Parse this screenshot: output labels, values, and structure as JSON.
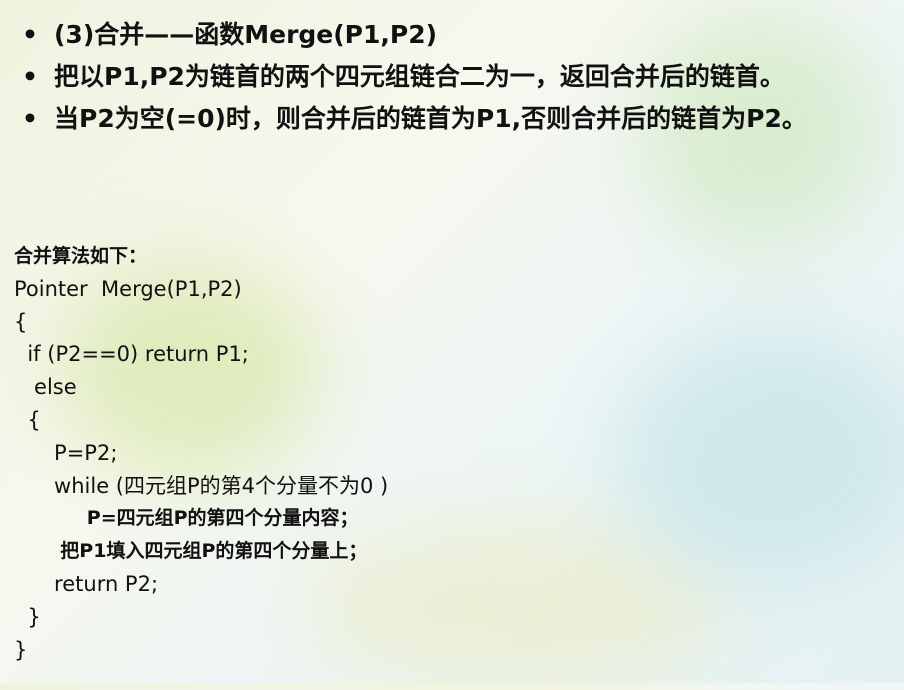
{
  "bullets": [
    {
      "marker": "•",
      "text": "(3)合并——函数Merge(P1,P2)"
    },
    {
      "marker": "•",
      "text": "把以P1,P2为链首的两个四元组链合二为一，返回合并后的链首。"
    },
    {
      "marker": "•",
      "text": "当P2为空(=0)时，则合并后的链首为P1,否则合并后的链首为P2。"
    }
  ],
  "code": {
    "title": "合并算法如下：",
    "lines": [
      "Pointer  Merge(P1,P2)",
      "{",
      "  if (P2==0) return P1;",
      "   else",
      "  {",
      "      P=P2;",
      "      while (四元组P的第4个分量不为0 )",
      "           P=四元组P的第四个分量内容；",
      "       把P1填入四元组P的第四个分量上；",
      "      return P2;",
      "  }",
      "}"
    ]
  }
}
